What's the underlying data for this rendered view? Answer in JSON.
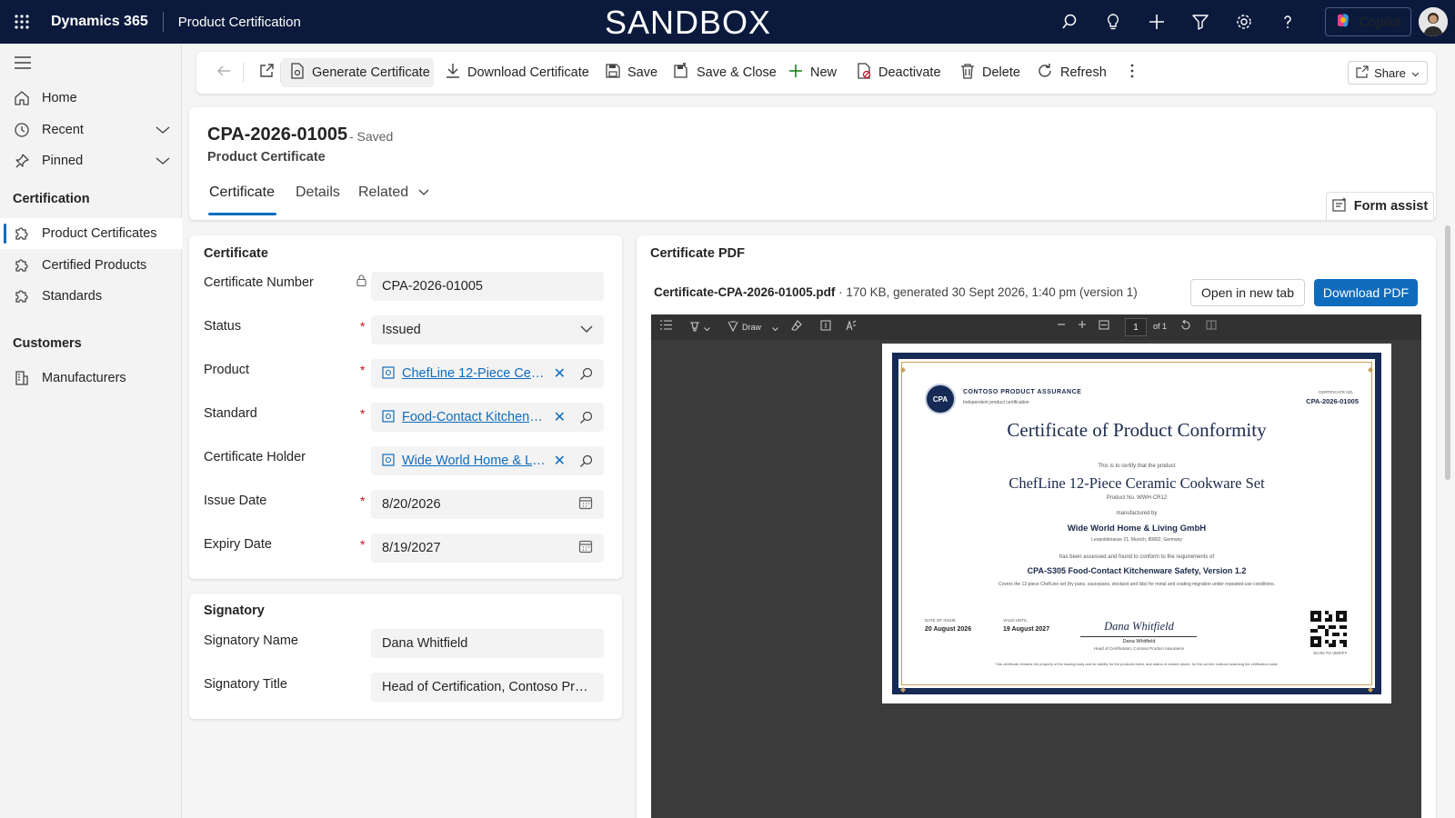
{
  "topbar": {
    "brand": "Dynamics 365",
    "app_name": "Product Certification",
    "environment_banner": "SANDBOX",
    "copilot_label": "Copilot",
    "icons": [
      "waffle-icon",
      "search-icon",
      "lightbulb-icon",
      "plus-icon",
      "filter-icon",
      "settings-icon",
      "help-icon"
    ]
  },
  "sidebar": {
    "items": [
      {
        "label": "Home",
        "icon": "home-icon"
      },
      {
        "label": "Recent",
        "icon": "clock-icon"
      },
      {
        "label": "Pinned",
        "icon": "pin-icon"
      }
    ],
    "groups": [
      {
        "title": "Certification",
        "items": [
          {
            "label": "Product Certificates",
            "icon": "puzzle-icon",
            "active": true
          },
          {
            "label": "Certified Products",
            "icon": "puzzle-icon"
          },
          {
            "label": "Standards",
            "icon": "puzzle-icon"
          }
        ]
      },
      {
        "title": "Customers",
        "items": [
          {
            "label": "Manufacturers",
            "icon": "building-icon"
          }
        ]
      }
    ]
  },
  "commandbar": {
    "generate_certificate": "Generate Certificate",
    "download_certificate": "Download Certificate",
    "save": "Save",
    "save_close": "Save & Close",
    "new": "New",
    "deactivate": "Deactivate",
    "delete": "Delete",
    "refresh": "Refresh",
    "share": "Share"
  },
  "record": {
    "title": "CPA-2026-01005",
    "save_status": "- Saved",
    "entity": "Product Certificate",
    "tabs": [
      "Certificate",
      "Details",
      "Related"
    ],
    "form_assist": "Form assist"
  },
  "certificate_section": {
    "title": "Certificate",
    "fields": {
      "number_label": "Certificate Number",
      "number_value": "CPA-2026-01005",
      "status_label": "Status",
      "status_value": "Issued",
      "product_label": "Product",
      "product_value": "ChefLine 12-Piece Ceram...",
      "standard_label": "Standard",
      "standard_value": "Food-Contact Kitchenwar...",
      "holder_label": "Certificate Holder",
      "holder_value": "Wide World Home & Livi...",
      "issue_label": "Issue Date",
      "issue_value": "8/20/2026",
      "expiry_label": "Expiry Date",
      "expiry_value": "8/19/2027"
    }
  },
  "signatory_section": {
    "title": "Signatory",
    "name_label": "Signatory Name",
    "name_value": "Dana Whitfield",
    "title_label": "Signatory Title",
    "title_value": "Head of Certification, Contoso Prod..."
  },
  "pdf_section": {
    "title": "Certificate PDF",
    "file_name": "Certificate-CPA-2026-01005.pdf",
    "file_meta": " · 170 KB, generated 30 Sept 2026, 1:40 pm (version 1)",
    "open_new_tab": "Open in new tab",
    "download_pdf": "Download PDF",
    "viewer": {
      "draw_label": "Draw",
      "page_number": "1",
      "page_of": "of 1"
    }
  },
  "certificate_document": {
    "seal_text": "CPA",
    "org_name": "CONTOSO PRODUCT ASSURANCE",
    "org_tagline": "Independent product certification",
    "cert_no_label": "CERTIFICATE NO.",
    "cert_no": "CPA-2026-01005",
    "heading": "Certificate of Product Conformity",
    "certify_line": "This is to certify that the product",
    "product_name": "ChefLine 12-Piece Ceramic Cookware Set",
    "product_no": "Product No. WWH-CR12",
    "manufactured_by": "manufactured by",
    "manufacturer": "Wide World Home & Living GmbH",
    "address": "Leopoldstrasse 21, Munich, 80802, Germany",
    "assessed_line": "has been assessed and found to conform to the requirements of",
    "standard": "CPA-S305  Food-Contact Kitchenware Safety, Version 1.2",
    "scope": "Covers the 12-piece ChefLine set (fry pans, saucepans, stockpot and lids) for metal and coating migration under repeated-use conditions.",
    "issue_label": "DATE OF ISSUE",
    "issue_date": "20 August 2026",
    "valid_label": "VALID UNTIL",
    "valid_date": "19 August 2027",
    "signature": "Dana Whitfield",
    "signatory_name": "Dana Whitfield",
    "signatory_title": "Head of Certification, Contoso Product Assurance",
    "scan_label": "SCAN TO VERIFY",
    "footer_note": "This certificate remains the property of the issuing body and its validity for the products listed, and status of named above, for the current contract scanning the verification code."
  }
}
